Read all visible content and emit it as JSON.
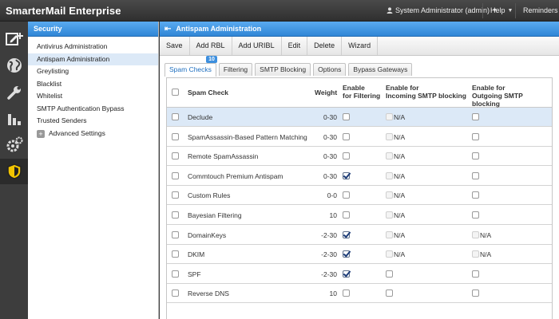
{
  "app": {
    "title": "SmarterMail Enterprise"
  },
  "top_menu": {
    "user": "System Administrator (admin)",
    "help": "Help",
    "reminders": "Reminders"
  },
  "icon_bar": [
    {
      "name": "compose-icon"
    },
    {
      "name": "globe-icon"
    },
    {
      "name": "wrench-icon"
    },
    {
      "name": "bar-chart-icon"
    },
    {
      "name": "gears-icon"
    },
    {
      "name": "security-shield-icon"
    }
  ],
  "sidebar": {
    "title": "Security",
    "items": [
      {
        "label": "Antivirus Administration"
      },
      {
        "label": "Antispam Administration"
      },
      {
        "label": "Greylisting"
      },
      {
        "label": "Blacklist"
      },
      {
        "label": "Whitelist"
      },
      {
        "label": "SMTP Authentication Bypass"
      },
      {
        "label": "Trusted Senders"
      },
      {
        "label": "Advanced Settings"
      }
    ]
  },
  "main": {
    "title": "Antispam Administration",
    "toolbar": [
      "Save",
      "Add RBL",
      "Add URIBL",
      "Edit",
      "Delete",
      "Wizard"
    ],
    "tabs": [
      {
        "label": "Spam Checks",
        "badge": "10"
      },
      {
        "label": "Filtering"
      },
      {
        "label": "SMTP Blocking"
      },
      {
        "label": "Options"
      },
      {
        "label": "Bypass Gateways"
      }
    ]
  },
  "table": {
    "headers": {
      "spam_check": "Spam Check",
      "weight": "Weight",
      "filtering_1": "Enable",
      "filtering_2": "for Filtering",
      "incoming_1": "Enable for",
      "incoming_2": "Incoming SMTP blocking",
      "outgoing_1": "Enable for",
      "outgoing_2": "Outgoing SMTP blocking"
    },
    "rows": [
      {
        "name": "Declude",
        "weight": "0-30",
        "filtering": false,
        "incoming": "N/A",
        "outgoing": "cb"
      },
      {
        "name": "SpamAssassin-Based Pattern Matching",
        "weight": "0-30",
        "filtering": false,
        "incoming": "N/A",
        "outgoing": "cb"
      },
      {
        "name": "Remote SpamAssassin",
        "weight": "0-30",
        "filtering": false,
        "incoming": "N/A",
        "outgoing": "cb"
      },
      {
        "name": "Commtouch Premium Antispam",
        "weight": "0-30",
        "filtering": true,
        "incoming": "N/A",
        "outgoing": "cb"
      },
      {
        "name": "Custom Rules",
        "weight": "0-0",
        "filtering": false,
        "incoming": "N/A",
        "outgoing": "cb"
      },
      {
        "name": "Bayesian Filtering",
        "weight": "10",
        "filtering": false,
        "incoming": "N/A",
        "outgoing": "cb"
      },
      {
        "name": "DomainKeys",
        "weight": "-2-30",
        "filtering": true,
        "incoming": "N/A",
        "outgoing": "N/A"
      },
      {
        "name": "DKIM",
        "weight": "-2-30",
        "filtering": true,
        "incoming": "N/A",
        "outgoing": "N/A"
      },
      {
        "name": "SPF",
        "weight": "-2-30",
        "filtering": true,
        "incoming": "cb",
        "outgoing": "cb"
      },
      {
        "name": "Reverse DNS",
        "weight": "10",
        "filtering": false,
        "incoming": "cb",
        "outgoing": "cb"
      }
    ]
  },
  "colors": {
    "accent": "#2f86d6",
    "selected_row": "#dce9f7"
  }
}
